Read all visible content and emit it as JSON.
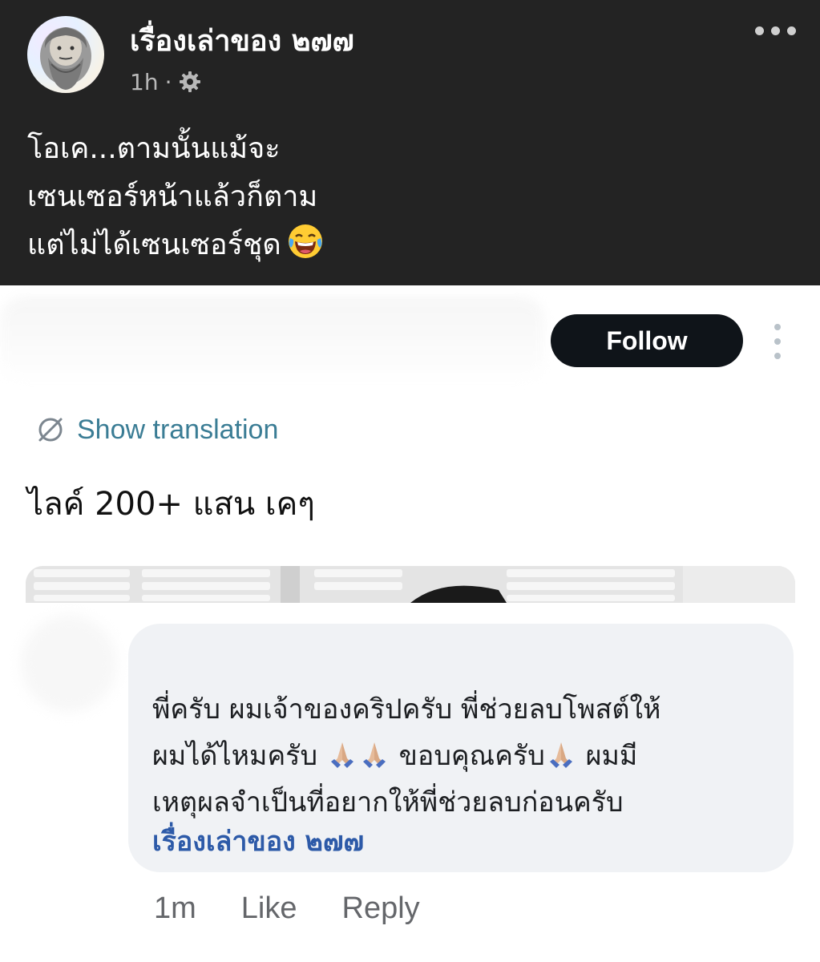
{
  "post": {
    "page_name": "เรื่องเล่าของ ๒๗๗",
    "time": "1h",
    "separator": "·",
    "audience_icon": "gear-icon",
    "more_icon": "more-horizontal-icon",
    "text_lines": [
      "โอเค...ตามนั้นแม้จะ",
      "เซนเซอร์หน้าแล้วก็ตาม",
      "แต่ไม่ได้เซนเซอร์ชุด"
    ],
    "emoji": "face-with-tears-of-joy"
  },
  "screenshot": {
    "follow_label": "Follow",
    "translate_label": "Show translation",
    "tweet_text": "ไลค์ 200+ แสน เคๆ"
  },
  "comment": {
    "line1": "พี่ครับ ผมเจ้าของคริปครับ พี่ช่วยลบโพสต์ให้",
    "line2_a": "ผมได้ไหมครับ",
    "line2_b": "ขอบคุณครับ",
    "line2_c": "ผมมี",
    "line3": "เหตุผลจำเป็นที่อยากให้พี่ช่วยลบก่อนครับ",
    "mention": "เรื่องเล่าของ ๒๗๗",
    "time": "1m",
    "like_label": "Like",
    "reply_label": "Reply"
  },
  "colors": {
    "header_bg": "#232323",
    "follow_bg": "#0f1419",
    "translate_blue": "#3b7d95",
    "mention_blue": "#2d5aa8",
    "bubble_bg": "#f0f2f5"
  }
}
